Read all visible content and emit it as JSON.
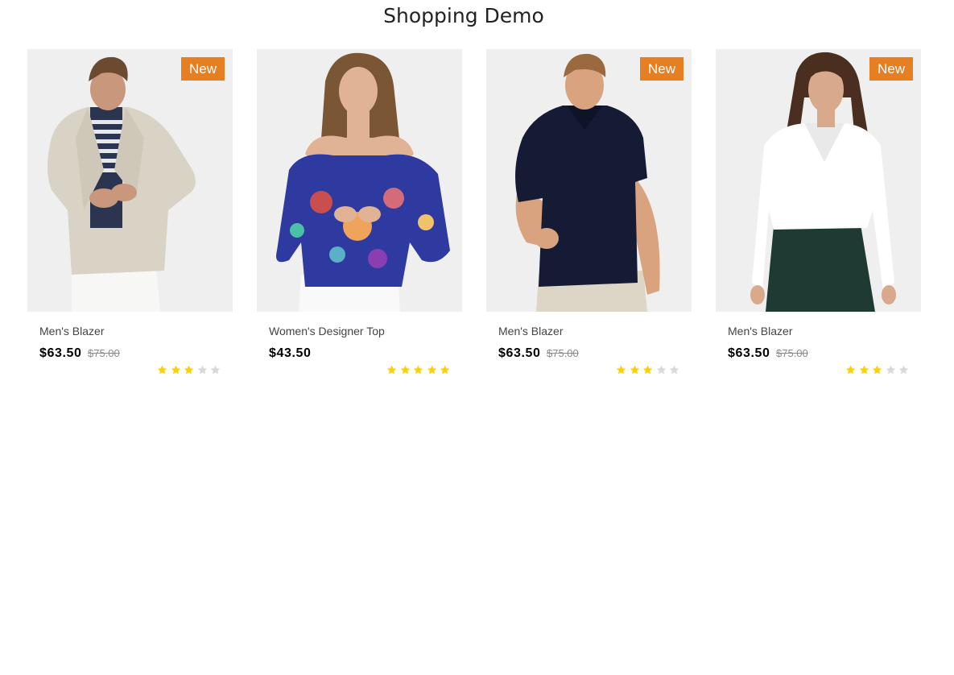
{
  "page": {
    "title": "Shopping Demo"
  },
  "colors": {
    "badge": "#e67e22",
    "star_filled": "#ffd000",
    "star_empty": "#d8d8d8",
    "image_background": "#efefef"
  },
  "products": [
    {
      "name": "Men's Blazer",
      "price": "$63.50",
      "old_price": "$75.00",
      "badge": "New",
      "rating": 3,
      "rating_max": 5,
      "photo": "man-in-beige-blazer"
    },
    {
      "name": "Women's Designer Top",
      "price": "$43.50",
      "old_price": "",
      "badge": "",
      "rating": 5,
      "rating_max": 5,
      "photo": "woman-in-patterned-blue-top"
    },
    {
      "name": "Men's Blazer",
      "price": "$63.50",
      "old_price": "$75.00",
      "badge": "New",
      "rating": 3,
      "rating_max": 5,
      "photo": "man-in-navy-polo"
    },
    {
      "name": "Men's Blazer",
      "price": "$63.50",
      "old_price": "$75.00",
      "badge": "New",
      "rating": 3,
      "rating_max": 5,
      "photo": "woman-in-white-shirt"
    }
  ]
}
